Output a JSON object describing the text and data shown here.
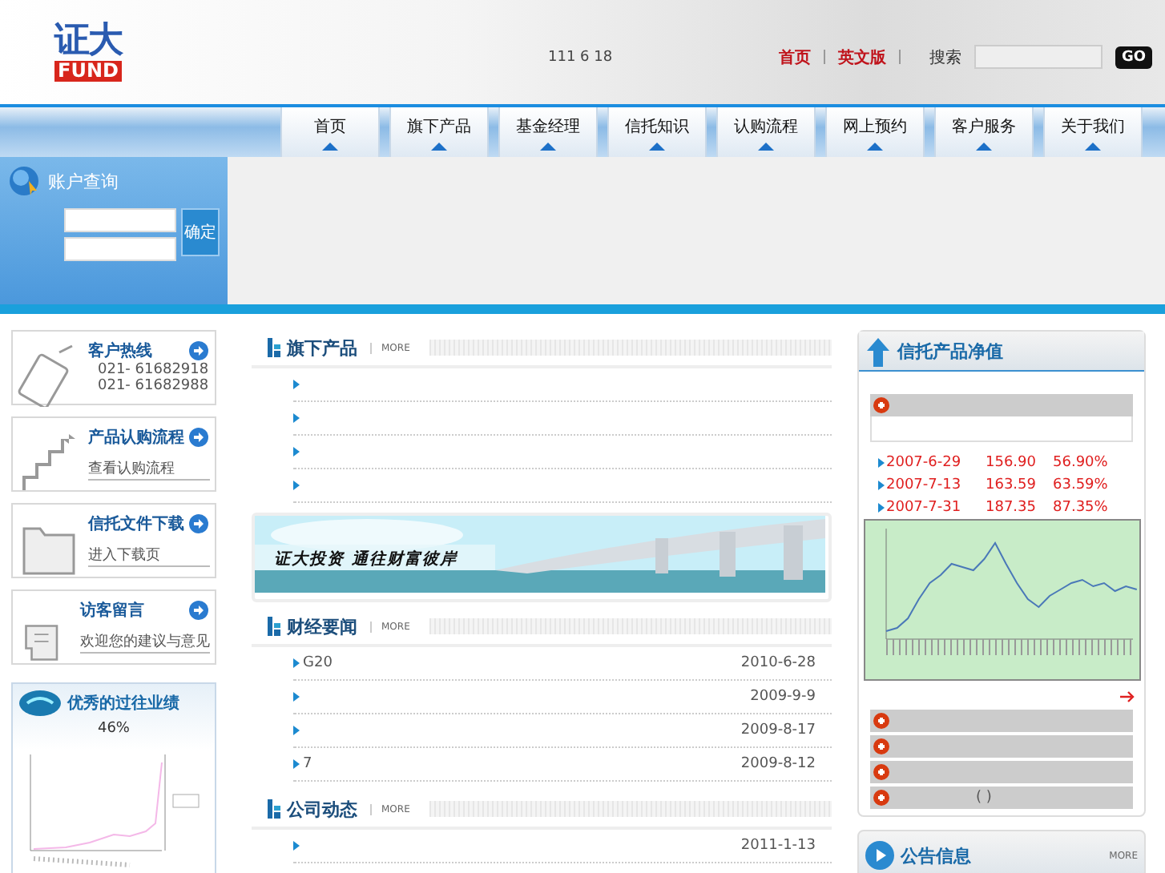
{
  "header": {
    "logo_top": "证大",
    "logo_bottom": "FUND",
    "date_text": "111 6 18",
    "links": [
      "首页",
      "英文版"
    ],
    "search_label": "搜索",
    "search_button": "GO"
  },
  "nav": [
    {
      "label": "首页"
    },
    {
      "label": "旗下产品"
    },
    {
      "label": "基金经理"
    },
    {
      "label": "信托知识"
    },
    {
      "label": "认购流程"
    },
    {
      "label": "网上预约"
    },
    {
      "label": "客户服务"
    },
    {
      "label": "关于我们"
    }
  ],
  "account": {
    "title": "账户查询",
    "button": "确定"
  },
  "side_cards": [
    {
      "kind": "phone",
      "title": "客户热线",
      "lines": [
        "021- 61682918",
        "021- 61682988"
      ]
    },
    {
      "kind": "stairs",
      "title": "产品认购流程",
      "link": "查看认购流程"
    },
    {
      "kind": "folder",
      "title": "信托文件下载",
      "link": "进入下载页"
    },
    {
      "kind": "hand",
      "title": "访客留言",
      "link": "欢迎您的建议与意见"
    }
  ],
  "performance": {
    "title": "优秀的过往业绩",
    "caption": "46%"
  },
  "sections": [
    {
      "title": "旗下产品",
      "more": "MORE",
      "rows": [
        {},
        {},
        {},
        {}
      ]
    },
    {
      "title": "财经要闻",
      "more": "MORE",
      "rows": [
        {
          "text": "G20",
          "date": "2010-6-28"
        },
        {
          "date": "2009-9-9"
        },
        {
          "date": "2009-8-17"
        },
        {
          "text": "7",
          "date": "2009-8-12"
        }
      ]
    },
    {
      "title": "公司动态",
      "more": "MORE",
      "rows": [
        {
          "date": "2011-1-13"
        }
      ]
    }
  ],
  "banner": {
    "slogan": "证大投资 通往财富彼岸"
  },
  "nav_panel": {
    "title": "信托产品净值",
    "rows": [
      {
        "date": "2007-6-29",
        "value": "156.90",
        "pct": "56.90%"
      },
      {
        "date": "2007-7-13",
        "value": "163.59",
        "pct": "63.59%"
      },
      {
        "date": "2007-7-31",
        "value": "187.35",
        "pct": "87.35%"
      }
    ],
    "bars": [
      {
        "kind": "bar"
      },
      {
        "kind": "bar"
      },
      {
        "kind": "bar"
      },
      {
        "kind": "bar",
        "text": "( )"
      }
    ]
  },
  "notice": {
    "title": "公告信息",
    "more": "MORE"
  }
}
